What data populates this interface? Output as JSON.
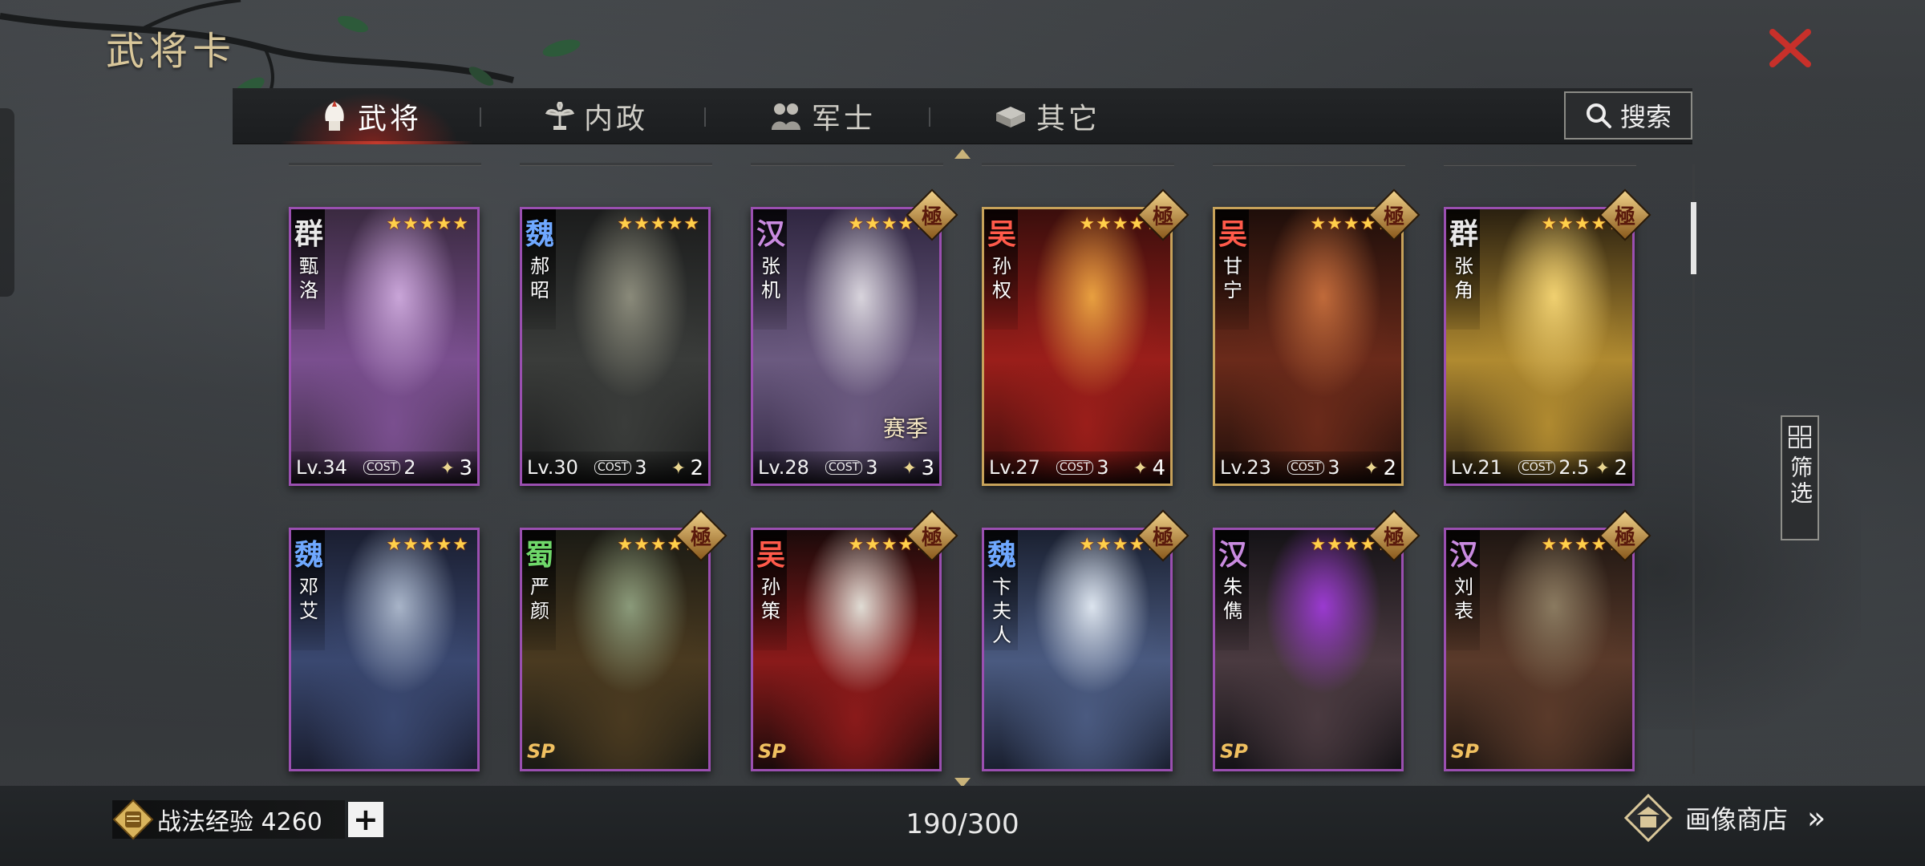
{
  "page_title": "武将卡",
  "tabs": [
    {
      "label": "武将",
      "icon": "helmet-icon",
      "active": true
    },
    {
      "label": "内政",
      "icon": "plant-icon",
      "active": false
    },
    {
      "label": "军士",
      "icon": "soldiers-icon",
      "active": false
    },
    {
      "label": "其它",
      "icon": "chest-icon",
      "active": false
    }
  ],
  "search": {
    "label": "搜索"
  },
  "filter": {
    "label": "筛选"
  },
  "cards": [
    {
      "faction": "群",
      "faction_color": "#e8e8e8",
      "name": "甄洛",
      "stars": "★★★★★",
      "level": "Lv.34",
      "cost_label": "COST",
      "cost": "2",
      "tactic_icon": "bow-icon",
      "tactic_count": "3",
      "ji": "",
      "season": "",
      "sp": "",
      "frame": "purple",
      "palette": [
        "#c9a5d8",
        "#7a4f8f",
        "#3a2a40"
      ]
    },
    {
      "faction": "魏",
      "faction_color": "#6fa8ff",
      "name": "郝昭",
      "stars": "★★★★★",
      "level": "Lv.30",
      "cost_label": "COST",
      "cost": "3",
      "tactic_icon": "shield-icon",
      "tactic_count": "2",
      "ji": "",
      "season": "",
      "sp": "",
      "frame": "purple",
      "palette": [
        "#8a8a7a",
        "#3a3c3a",
        "#1b1c1c"
      ]
    },
    {
      "faction": "汉",
      "faction_color": "#c98be0",
      "name": "张机",
      "stars": "★★★★★",
      "level": "Lv.28",
      "cost_label": "COST",
      "cost": "3",
      "tactic_icon": "bow-icon",
      "tactic_count": "3",
      "ji": "極",
      "season": "赛季",
      "sp": "",
      "frame": "purple",
      "palette": [
        "#d8d4dc",
        "#6b5a80",
        "#2f2640"
      ]
    },
    {
      "faction": "吴",
      "faction_color": "#ff5a4a",
      "name": "孙权",
      "stars": "★★★★★",
      "level": "Lv.27",
      "cost_label": "COST",
      "cost": "3",
      "tactic_icon": "bow-icon",
      "tactic_count": "4",
      "ji": "極",
      "season": "",
      "sp": "",
      "frame": "gold",
      "palette": [
        "#e8a040",
        "#9a1e1a",
        "#3a0e0c"
      ]
    },
    {
      "faction": "吴",
      "faction_color": "#ff5a4a",
      "name": "甘宁",
      "stars": "★★★★★",
      "level": "Lv.23",
      "cost_label": "COST",
      "cost": "3",
      "tactic_icon": "flame-icon",
      "tactic_count": "2",
      "ji": "極",
      "season": "",
      "sp": "",
      "frame": "gold",
      "palette": [
        "#c06a3a",
        "#6a2a1a",
        "#1e0e0a"
      ]
    },
    {
      "faction": "群",
      "faction_color": "#e8e8e8",
      "name": "张角",
      "stars": "★★★★★",
      "level": "Lv.21",
      "cost_label": "COST",
      "cost": "2.5",
      "tactic_icon": "flame-icon",
      "tactic_count": "2",
      "ji": "極",
      "season": "",
      "sp": "",
      "frame": "purple",
      "palette": [
        "#f0d070",
        "#b08a30",
        "#2a2010"
      ]
    },
    {
      "faction": "魏",
      "faction_color": "#6fa8ff",
      "name": "邓艾",
      "stars": "★★★★★",
      "level": "",
      "cost_label": "",
      "cost": "",
      "tactic_icon": "",
      "tactic_count": "",
      "ji": "",
      "season": "",
      "sp": "",
      "frame": "purple",
      "palette": [
        "#a8b4c8",
        "#3a4870",
        "#1a1e30"
      ]
    },
    {
      "faction": "蜀",
      "faction_color": "#6fd86a",
      "name": "严颜",
      "stars": "★★★★★",
      "level": "",
      "cost_label": "",
      "cost": "",
      "tactic_icon": "",
      "tactic_count": "",
      "ji": "極",
      "season": "",
      "sp": "SP",
      "frame": "purple",
      "palette": [
        "#8a9a7a",
        "#4a3a20",
        "#1a1a14"
      ]
    },
    {
      "faction": "吴",
      "faction_color": "#ff5a4a",
      "name": "孙策",
      "stars": "★★★★★",
      "level": "",
      "cost_label": "",
      "cost": "",
      "tactic_icon": "",
      "tactic_count": "",
      "ji": "極",
      "season": "",
      "sp": "SP",
      "frame": "purple",
      "palette": [
        "#e0dcd4",
        "#8a1a1a",
        "#1a0a0a"
      ]
    },
    {
      "faction": "魏",
      "faction_color": "#6fa8ff",
      "name": "卞夫人",
      "stars": "★★★★★",
      "level": "",
      "cost_label": "",
      "cost": "",
      "tactic_icon": "",
      "tactic_count": "",
      "ji": "極",
      "season": "",
      "sp": "",
      "frame": "purple",
      "palette": [
        "#dce4ee",
        "#4a5a80",
        "#1a2030"
      ]
    },
    {
      "faction": "汉",
      "faction_color": "#c98be0",
      "name": "朱儁",
      "stars": "★★★★★",
      "level": "",
      "cost_label": "",
      "cost": "",
      "tactic_icon": "",
      "tactic_count": "",
      "ji": "極",
      "season": "",
      "sp": "SP",
      "frame": "purple",
      "palette": [
        "#9a3ad0",
        "#4a3a40",
        "#141216"
      ]
    },
    {
      "faction": "汉",
      "faction_color": "#c98be0",
      "name": "刘表",
      "stars": "★★★★★",
      "level": "",
      "cost_label": "",
      "cost": "",
      "tactic_icon": "",
      "tactic_count": "",
      "ji": "極",
      "season": "",
      "sp": "SP",
      "frame": "purple",
      "palette": [
        "#8a7a60",
        "#5a3a2a",
        "#1e1612"
      ]
    }
  ],
  "bottom": {
    "exp_label": "战法经验 4260",
    "add_label": "+",
    "count": "190/300",
    "shop_label": "画像商店",
    "shop_arrow": "»"
  },
  "colors": {
    "accent_red": "#c23a2c",
    "gold": "#c9b37a",
    "purple_frame": "#9a4fb0"
  }
}
